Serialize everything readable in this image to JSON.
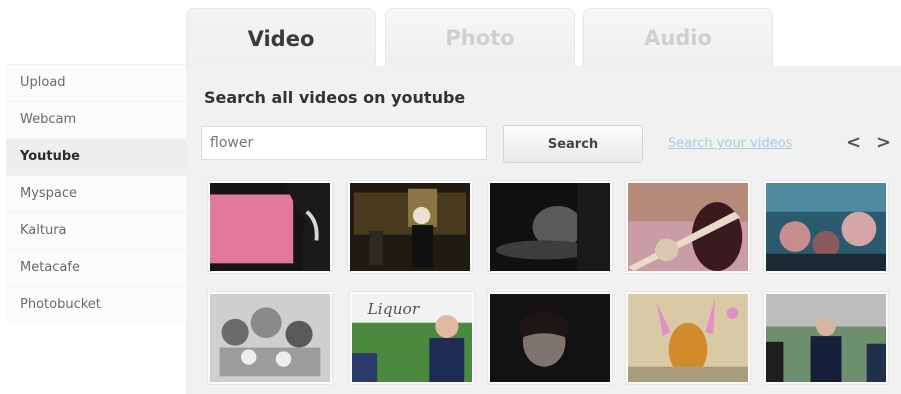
{
  "tabs": [
    {
      "label": "Video",
      "active": true
    },
    {
      "label": "Photo",
      "active": false
    },
    {
      "label": "Audio",
      "active": false
    }
  ],
  "sidebar": {
    "items": [
      {
        "label": "Upload"
      },
      {
        "label": "Webcam"
      },
      {
        "label": "Youtube",
        "active": true
      },
      {
        "label": "Myspace"
      },
      {
        "label": "Kaltura"
      },
      {
        "label": "Metacafe"
      },
      {
        "label": "Photobucket"
      }
    ]
  },
  "main": {
    "title": "Search all videos on youtube",
    "search": {
      "value": "flower",
      "button_label": "Search"
    },
    "your_videos_link": "Search your videos",
    "pager": {
      "prev": "<",
      "next": ">"
    },
    "thumbnails": [
      {
        "row": 1,
        "col": 1
      },
      {
        "row": 1,
        "col": 2
      },
      {
        "row": 1,
        "col": 3
      },
      {
        "row": 1,
        "col": 4
      },
      {
        "row": 1,
        "col": 5
      },
      {
        "row": 2,
        "col": 1
      },
      {
        "row": 2,
        "col": 2
      },
      {
        "row": 2,
        "col": 3
      },
      {
        "row": 2,
        "col": 4
      },
      {
        "row": 2,
        "col": 5
      }
    ],
    "thumbnail_text": {
      "banner": "Liquor"
    }
  },
  "colors": {
    "panel_bg": "#f1f1f1",
    "link": "#a9cdd9",
    "active_tab_text": "#3a3a3a",
    "inactive_tab_text": "#d0d0d0"
  }
}
